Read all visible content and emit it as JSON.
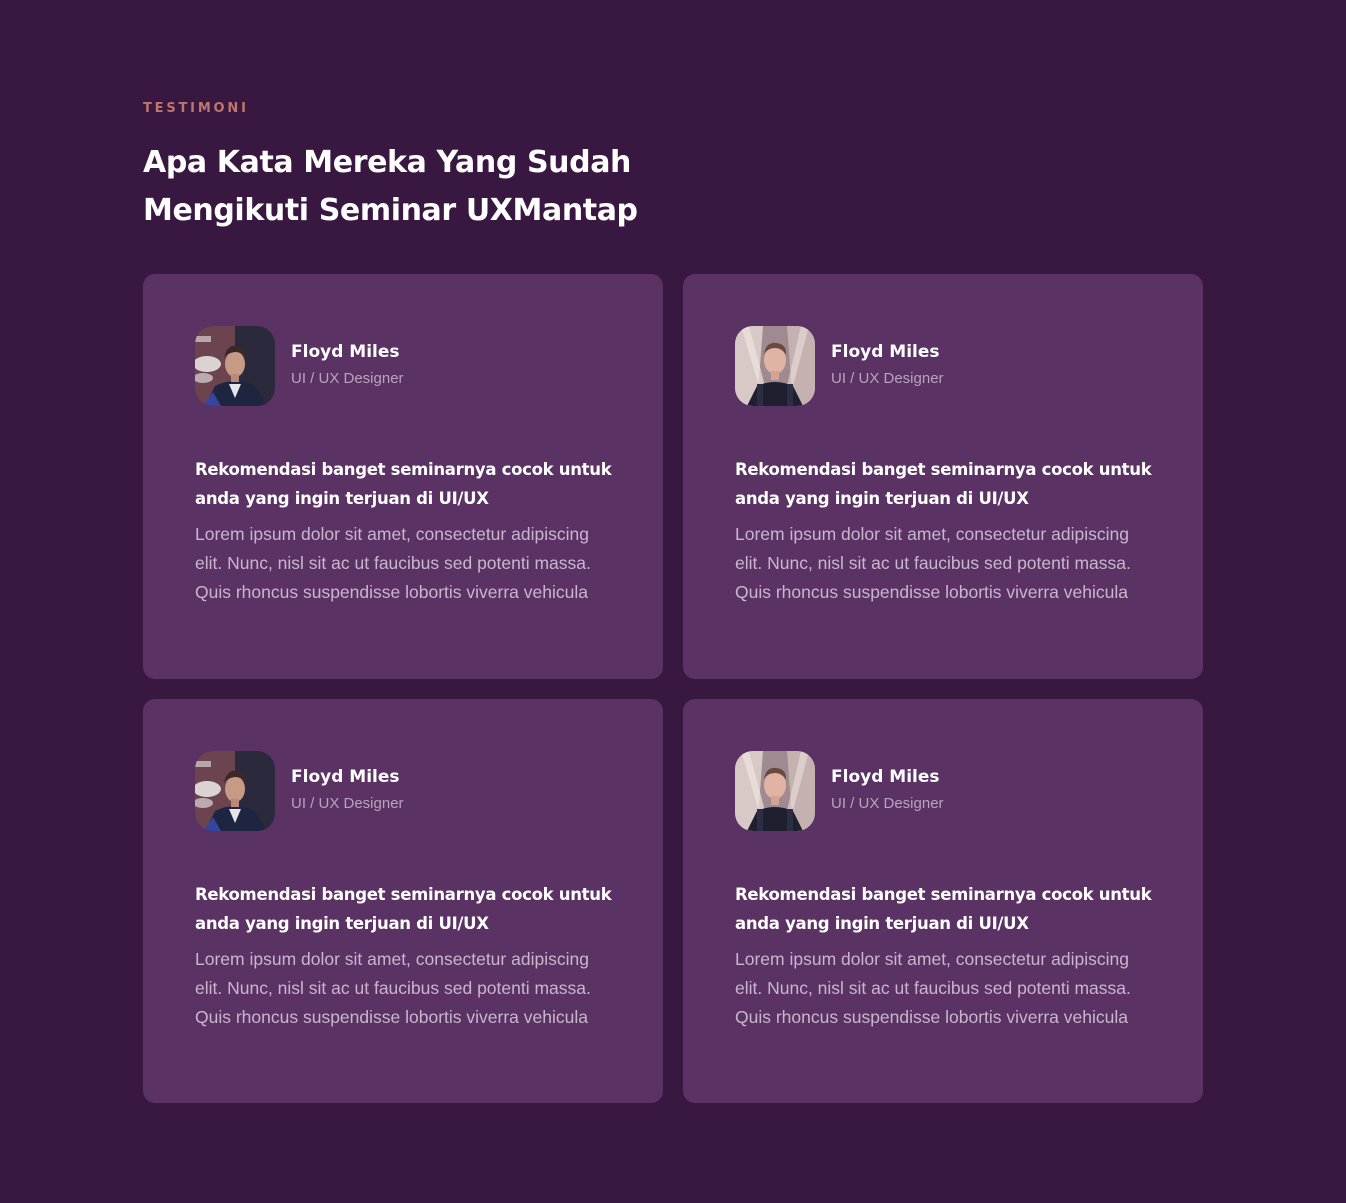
{
  "section": {
    "eyebrow": "TESTIMONI",
    "heading": "Apa Kata Mereka Yang Sudah Mengikuti Seminar UXMantap"
  },
  "testimonials": [
    {
      "name": "Floyd Miles",
      "role": "UI / UX Designer",
      "title": "Rekomendasi banget seminarnya cocok untuk anda yang ingin terjuan di UI/UX",
      "body": "Lorem ipsum dolor sit amet, consectetur adipiscing elit. Nunc, nisl sit ac ut faucibus sed potenti massa. Quis rhoncus suspendisse lobortis viverra vehicula",
      "avatar": "man-in-suit"
    },
    {
      "name": "Floyd Miles",
      "role": "UI / UX Designer",
      "title": "Rekomendasi banget seminarnya cocok untuk anda yang ingin terjuan di UI/UX",
      "body": "Lorem ipsum dolor sit amet, consectetur adipiscing elit. Nunc, nisl sit ac ut faucibus sed potenti massa. Quis rhoncus suspendisse lobortis viverra vehicula",
      "avatar": "man-with-backpack"
    },
    {
      "name": "Floyd Miles",
      "role": "UI / UX Designer",
      "title": "Rekomendasi banget seminarnya cocok untuk anda yang ingin terjuan di UI/UX",
      "body": "Lorem ipsum dolor sit amet, consectetur adipiscing elit. Nunc, nisl sit ac ut faucibus sed potenti massa. Quis rhoncus suspendisse lobortis viverra vehicula",
      "avatar": "man-in-suit"
    },
    {
      "name": "Floyd Miles",
      "role": "UI / UX Designer",
      "title": "Rekomendasi banget seminarnya cocok untuk anda yang ingin terjuan di UI/UX",
      "body": "Lorem ipsum dolor sit amet, consectetur adipiscing elit. Nunc, nisl sit ac ut faucibus sed potenti massa. Quis rhoncus suspendisse lobortis viverra vehicula",
      "avatar": "man-with-backpack"
    }
  ],
  "colors": {
    "background": "#381840",
    "card": "#5a3264",
    "eyebrow": "#c0766b",
    "heading": "#ffffff",
    "role": "#b9a4bd",
    "body": "#c9b6cd"
  }
}
